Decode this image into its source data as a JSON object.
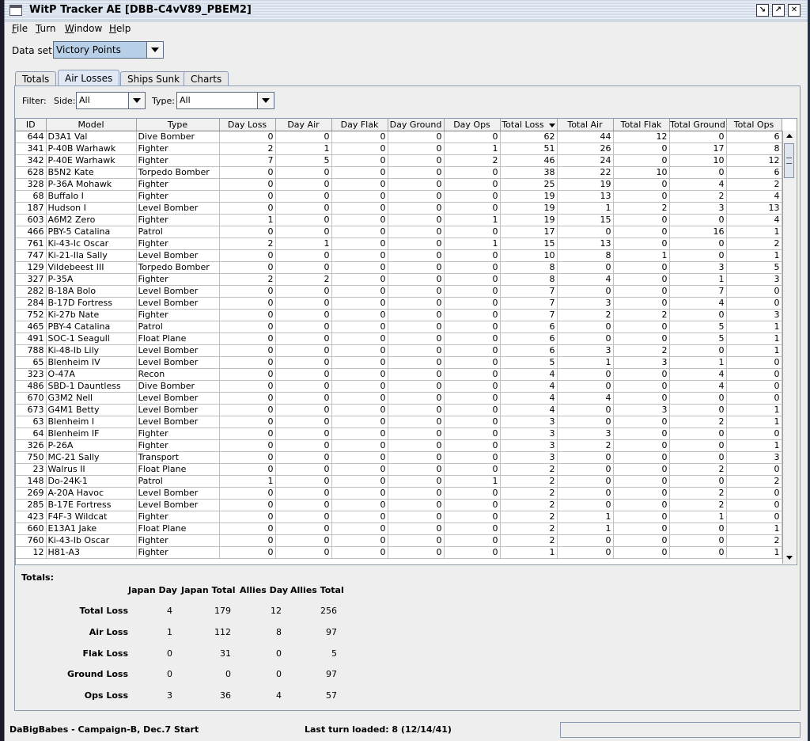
{
  "window": {
    "title": "WitP Tracker AE [DBB-C4vV89_PBEM2]"
  },
  "menu": [
    {
      "u": "F",
      "rest": "ile"
    },
    {
      "u": "T",
      "rest": "urn"
    },
    {
      "u": "W",
      "rest": "indow"
    },
    {
      "u": "H",
      "rest": "elp"
    }
  ],
  "dataset": {
    "label": "Data set:",
    "value": "Victory Points"
  },
  "tabs": [
    "Totals",
    "Air Losses",
    "Ships Sunk",
    "Charts"
  ],
  "active_tab": 1,
  "filter": {
    "label": "Filter:",
    "side_label": "Side:",
    "side_value": "All",
    "type_label": "Type:",
    "type_value": "All"
  },
  "table": {
    "headers": [
      "ID",
      "Model",
      "Type",
      "Day Loss",
      "Day Air",
      "Day Flak",
      "Day Ground",
      "Day Ops",
      "Total Loss",
      "Total Air",
      "Total Flak",
      "Total Ground",
      "Total Ops"
    ],
    "sorted_column": 8,
    "rows": [
      [
        "644",
        "D3A1 Val",
        "Dive Bomber",
        "0",
        "0",
        "0",
        "0",
        "0",
        "62",
        "44",
        "12",
        "0",
        "6"
      ],
      [
        "341",
        "P-40B Warhawk",
        "Fighter",
        "2",
        "1",
        "0",
        "0",
        "1",
        "51",
        "26",
        "0",
        "17",
        "8"
      ],
      [
        "342",
        "P-40E Warhawk",
        "Fighter",
        "7",
        "5",
        "0",
        "0",
        "2",
        "46",
        "24",
        "0",
        "10",
        "12"
      ],
      [
        "628",
        "B5N2 Kate",
        "Torpedo Bomber",
        "0",
        "0",
        "0",
        "0",
        "0",
        "38",
        "22",
        "10",
        "0",
        "6"
      ],
      [
        "328",
        "P-36A Mohawk",
        "Fighter",
        "0",
        "0",
        "0",
        "0",
        "0",
        "25",
        "19",
        "0",
        "4",
        "2"
      ],
      [
        "68",
        "Buffalo I",
        "Fighter",
        "0",
        "0",
        "0",
        "0",
        "0",
        "19",
        "13",
        "0",
        "2",
        "4"
      ],
      [
        "187",
        "Hudson I",
        "Level Bomber",
        "0",
        "0",
        "0",
        "0",
        "0",
        "19",
        "1",
        "2",
        "3",
        "13"
      ],
      [
        "603",
        "A6M2 Zero",
        "Fighter",
        "1",
        "0",
        "0",
        "0",
        "1",
        "19",
        "15",
        "0",
        "0",
        "4"
      ],
      [
        "466",
        "PBY-5 Catalina",
        "Patrol",
        "0",
        "0",
        "0",
        "0",
        "0",
        "17",
        "0",
        "0",
        "16",
        "1"
      ],
      [
        "761",
        "Ki-43-Ic Oscar",
        "Fighter",
        "2",
        "1",
        "0",
        "0",
        "1",
        "15",
        "13",
        "0",
        "0",
        "2"
      ],
      [
        "747",
        "Ki-21-IIa Sally",
        "Level Bomber",
        "0",
        "0",
        "0",
        "0",
        "0",
        "10",
        "8",
        "1",
        "0",
        "1"
      ],
      [
        "129",
        "Vildebeest III",
        "Torpedo Bomber",
        "0",
        "0",
        "0",
        "0",
        "0",
        "8",
        "0",
        "0",
        "3",
        "5"
      ],
      [
        "327",
        "P-35A",
        "Fighter",
        "2",
        "2",
        "0",
        "0",
        "0",
        "8",
        "4",
        "0",
        "1",
        "3"
      ],
      [
        "282",
        "B-18A Bolo",
        "Level Bomber",
        "0",
        "0",
        "0",
        "0",
        "0",
        "7",
        "0",
        "0",
        "7",
        "0"
      ],
      [
        "284",
        "B-17D Fortress",
        "Level Bomber",
        "0",
        "0",
        "0",
        "0",
        "0",
        "7",
        "3",
        "0",
        "4",
        "0"
      ],
      [
        "752",
        "Ki-27b Nate",
        "Fighter",
        "0",
        "0",
        "0",
        "0",
        "0",
        "7",
        "2",
        "2",
        "0",
        "3"
      ],
      [
        "465",
        "PBY-4 Catalina",
        "Patrol",
        "0",
        "0",
        "0",
        "0",
        "0",
        "6",
        "0",
        "0",
        "5",
        "1"
      ],
      [
        "491",
        "SOC-1 Seagull",
        "Float Plane",
        "0",
        "0",
        "0",
        "0",
        "0",
        "6",
        "0",
        "0",
        "5",
        "1"
      ],
      [
        "788",
        "Ki-48-Ib Lily",
        "Level Bomber",
        "0",
        "0",
        "0",
        "0",
        "0",
        "6",
        "3",
        "2",
        "0",
        "1"
      ],
      [
        "65",
        "Blenheim IV",
        "Level Bomber",
        "0",
        "0",
        "0",
        "0",
        "0",
        "5",
        "1",
        "3",
        "1",
        "0"
      ],
      [
        "323",
        "O-47A",
        "Recon",
        "0",
        "0",
        "0",
        "0",
        "0",
        "4",
        "0",
        "0",
        "4",
        "0"
      ],
      [
        "486",
        "SBD-1 Dauntless",
        "Dive Bomber",
        "0",
        "0",
        "0",
        "0",
        "0",
        "4",
        "0",
        "0",
        "4",
        "0"
      ],
      [
        "670",
        "G3M2 Nell",
        "Level Bomber",
        "0",
        "0",
        "0",
        "0",
        "0",
        "4",
        "4",
        "0",
        "0",
        "0"
      ],
      [
        "673",
        "G4M1 Betty",
        "Level Bomber",
        "0",
        "0",
        "0",
        "0",
        "0",
        "4",
        "0",
        "3",
        "0",
        "1"
      ],
      [
        "63",
        "Blenheim I",
        "Level Bomber",
        "0",
        "0",
        "0",
        "0",
        "0",
        "3",
        "0",
        "0",
        "2",
        "1"
      ],
      [
        "64",
        "Blenheim IF",
        "Fighter",
        "0",
        "0",
        "0",
        "0",
        "0",
        "3",
        "3",
        "0",
        "0",
        "0"
      ],
      [
        "326",
        "P-26A",
        "Fighter",
        "0",
        "0",
        "0",
        "0",
        "0",
        "3",
        "2",
        "0",
        "0",
        "1"
      ],
      [
        "750",
        "MC-21 Sally",
        "Transport",
        "0",
        "0",
        "0",
        "0",
        "0",
        "3",
        "0",
        "0",
        "0",
        "3"
      ],
      [
        "23",
        "Walrus II",
        "Float Plane",
        "0",
        "0",
        "0",
        "0",
        "0",
        "2",
        "0",
        "0",
        "2",
        "0"
      ],
      [
        "148",
        "Do-24K-1",
        "Patrol",
        "1",
        "0",
        "0",
        "0",
        "1",
        "2",
        "0",
        "0",
        "0",
        "2"
      ],
      [
        "269",
        "A-20A Havoc",
        "Level Bomber",
        "0",
        "0",
        "0",
        "0",
        "0",
        "2",
        "0",
        "0",
        "2",
        "0"
      ],
      [
        "285",
        "B-17E Fortress",
        "Level Bomber",
        "0",
        "0",
        "0",
        "0",
        "0",
        "2",
        "0",
        "0",
        "2",
        "0"
      ],
      [
        "423",
        "F4F-3 Wildcat",
        "Fighter",
        "0",
        "0",
        "0",
        "0",
        "0",
        "2",
        "1",
        "0",
        "1",
        "0"
      ],
      [
        "660",
        "E13A1 Jake",
        "Float Plane",
        "0",
        "0",
        "0",
        "0",
        "0",
        "2",
        "1",
        "0",
        "0",
        "1"
      ],
      [
        "760",
        "Ki-43-Ib Oscar",
        "Fighter",
        "0",
        "0",
        "0",
        "0",
        "0",
        "2",
        "0",
        "0",
        "0",
        "2"
      ],
      [
        "12",
        "H81-A3",
        "Fighter",
        "0",
        "0",
        "0",
        "0",
        "0",
        "1",
        "0",
        "0",
        "0",
        "1"
      ]
    ]
  },
  "totals": {
    "title": "Totals:",
    "columns": [
      "Japan Day",
      "Japan Total",
      "Allies Day",
      "Allies Total"
    ],
    "rows": [
      {
        "label": "Total Loss",
        "values": [
          "4",
          "179",
          "12",
          "256"
        ]
      },
      {
        "label": "Air Loss",
        "values": [
          "1",
          "112",
          "8",
          "97"
        ]
      },
      {
        "label": "Flak Loss",
        "values": [
          "0",
          "31",
          "0",
          "5"
        ]
      },
      {
        "label": "Ground Loss",
        "values": [
          "0",
          "0",
          "0",
          "97"
        ]
      },
      {
        "label": "Ops Loss",
        "values": [
          "3",
          "36",
          "4",
          "57"
        ]
      }
    ]
  },
  "status": {
    "left": "DaBigBabes - Campaign-B, Dec.7 Start",
    "last_turn": "Last turn loaded: 8 (12/14/41)"
  }
}
